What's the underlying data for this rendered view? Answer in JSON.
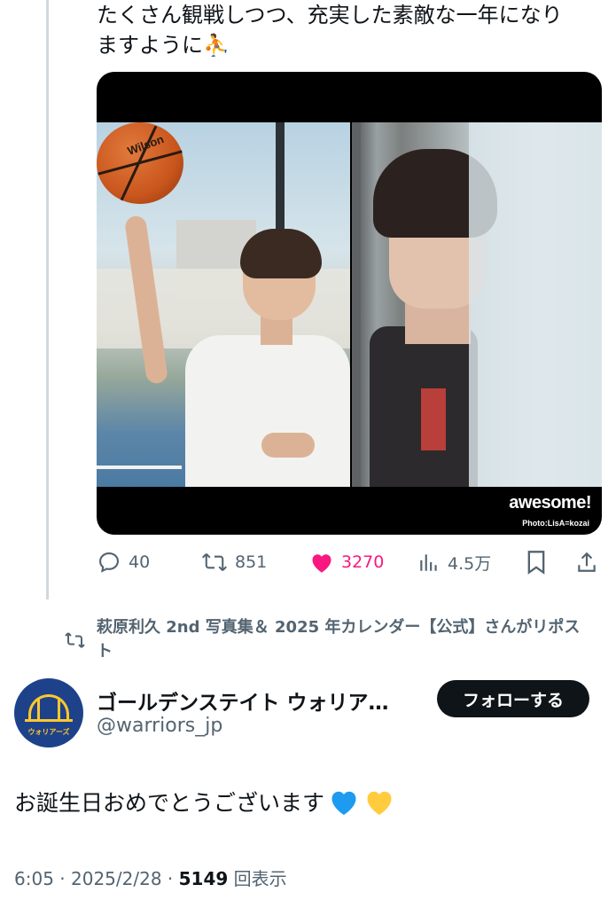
{
  "tweet_text": {
    "line1": "たくさん観戦しつつ、充実した素敵な一年になり",
    "line2": "ますように⛹️"
  },
  "media": {
    "watermark": "awesome!",
    "credit": "Photo:LisA=kozai",
    "ball_brand": "Wilson"
  },
  "actions": {
    "replies": "40",
    "reposts": "851",
    "likes": "3270",
    "views": "4.5万"
  },
  "repost_notice": "萩原利久 2nd 写真集＆ 2025 年カレンダー【公式】さんがリポスト",
  "author": {
    "name": "ゴールデンステイト ウォリア…",
    "handle": "@warriors_jp",
    "avatar_label": "ウォリアーズ"
  },
  "follow_button": "フォローする",
  "body": "お誕生日おめでとうございます",
  "meta": {
    "time": "6:05",
    "date": "2025/2/28",
    "views_count": "5149",
    "views_label": "回表示"
  },
  "colors": {
    "like": "#f91880",
    "secondary_text": "#536471",
    "primary_text": "#0f1419",
    "blue_heart": "#1d9bf0",
    "yellow_heart": "#ffcc3e"
  }
}
